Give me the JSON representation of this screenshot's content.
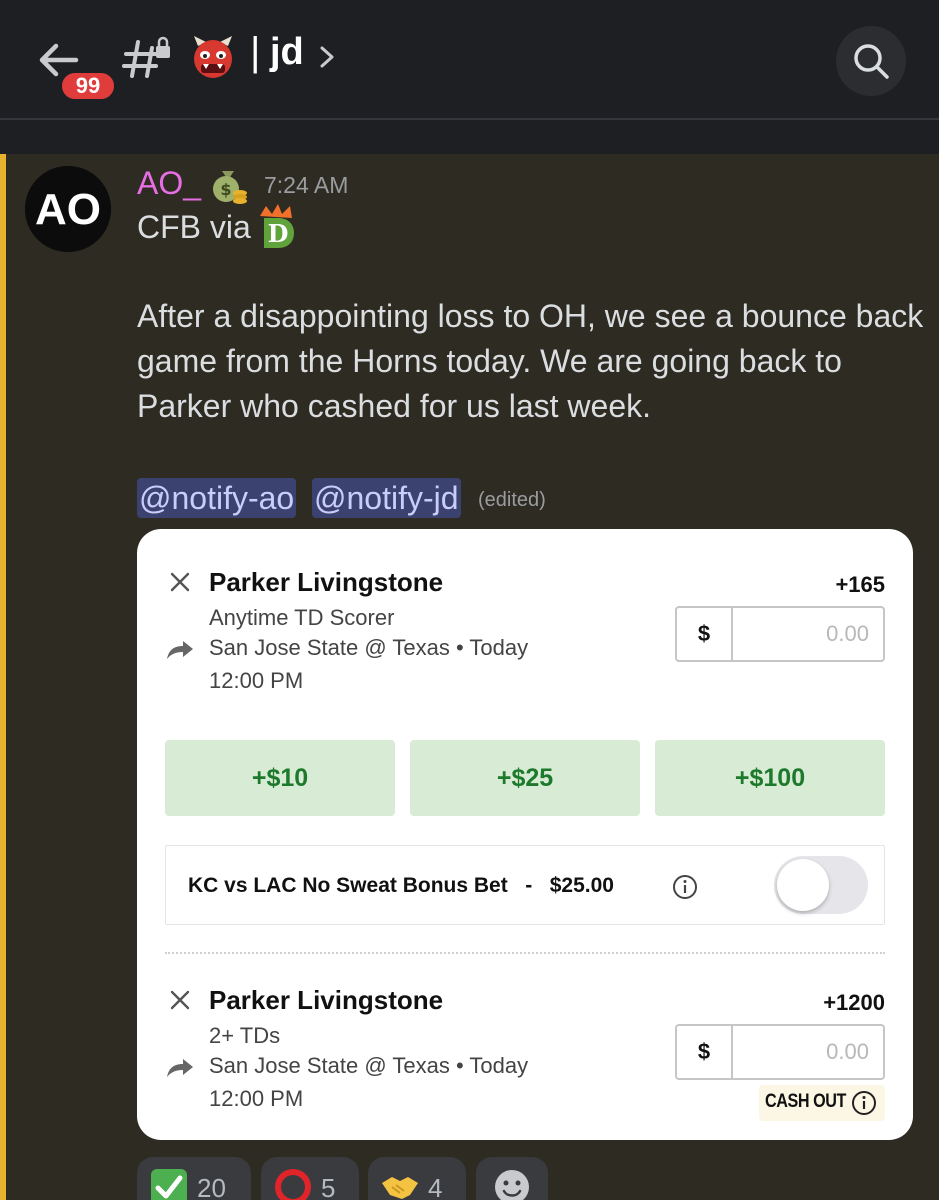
{
  "header": {
    "unread_badge": "99",
    "separator": "|",
    "channel_name": "jd",
    "icons": [
      "back-arrow-icon",
      "locked-channel-icon",
      "ogre-emoji-icon",
      "chevron-right-icon",
      "search-icon"
    ]
  },
  "message": {
    "avatar_text": "AO",
    "username": "AO_",
    "username_color": "#e86ee6",
    "timestamp": "7:24 AM",
    "line1": "CFB via",
    "paragraph": "After a disappointing loss to OH, we see a bounce back game from the Horns today. We are going back to Parker who cashed for us last week.",
    "mentions": [
      "@notify-ao",
      "@notify-jd"
    ],
    "edited_label": "(edited)",
    "accent_color": "#e8b22e"
  },
  "bet_card": {
    "legs": [
      {
        "player": "Parker Livingstone",
        "odds": "+165",
        "market": "Anytime TD Scorer",
        "game": "San Jose State @ Texas • Today",
        "time": "12:00 PM",
        "currency": "$",
        "amount_placeholder": "0.00"
      },
      {
        "player": "Parker Livingstone",
        "odds": "+1200",
        "market": "2+ TDs",
        "game": "San Jose State @ Texas • Today",
        "time": "12:00 PM",
        "currency": "$",
        "amount_placeholder": "0.00"
      }
    ],
    "quick_amounts": [
      "+$10",
      "+$25",
      "+$100"
    ],
    "promo_text": "KC vs LAC No Sweat Bonus Bet   -   $25.00",
    "promo_toggle_on": false,
    "cash_out_label": "CASH OUT",
    "accent_green": "#1d7a2c"
  },
  "reactions": [
    {
      "emoji": "check-mark-emoji",
      "count": "20"
    },
    {
      "emoji": "red-circle-emoji",
      "count": "5"
    },
    {
      "emoji": "handshake-emoji",
      "count": "4"
    },
    {
      "emoji": "add-reaction-icon",
      "count": ""
    }
  ]
}
